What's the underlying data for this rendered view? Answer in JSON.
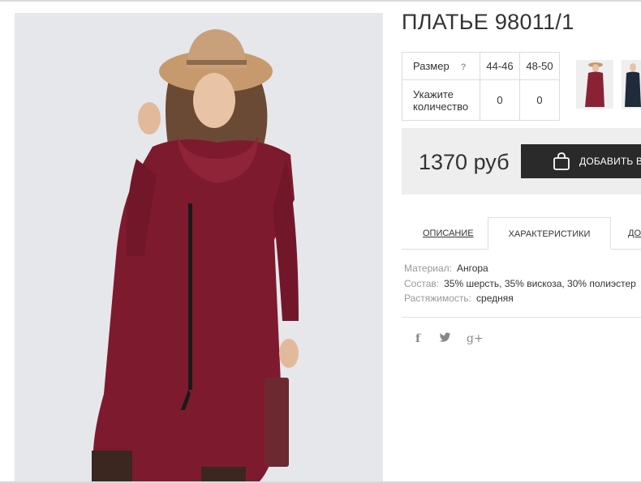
{
  "product": {
    "title": "ПЛАТЬЕ 98011/1",
    "price": "1370 руб",
    "add_to_cart_label": "ДОБАВИТЬ В ЗАКАЗ"
  },
  "size_table": {
    "size_label": "Размер",
    "help_mark": "?",
    "sizes": [
      "44-46",
      "48-50"
    ],
    "quantity_label_line1": "Укажите",
    "quantity_label_line2": "количество",
    "quantities": [
      "0",
      "0"
    ]
  },
  "tabs": [
    {
      "label": "ОПИСАНИЕ"
    },
    {
      "label": "ХАРАКТЕРИСТИКИ"
    },
    {
      "label": "ДО"
    }
  ],
  "characteristics": [
    {
      "key": "Материал:",
      "value": "Ангора"
    },
    {
      "key": "Состав:",
      "value": "35% шерсть, 35% вискоза, 30% полиэстер"
    },
    {
      "key": "Растяжимость:",
      "value": "средняя"
    }
  ],
  "share": {
    "facebook": "f",
    "twitter_icon": "twitter-icon",
    "googleplus": "g+"
  },
  "colors": {
    "dress": "#7e1a2e",
    "hat": "#c69a6c",
    "button_bg": "#2a2a2a",
    "price_bg": "#eeeeee"
  }
}
